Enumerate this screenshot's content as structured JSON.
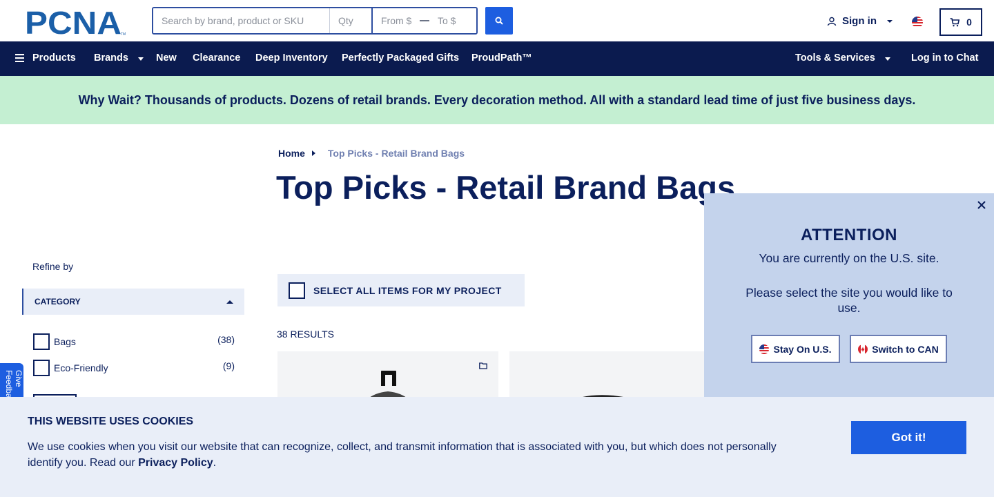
{
  "header": {
    "logo_text": "PCNA",
    "search": {
      "placeholder": "Search by brand, product or SKU",
      "value": ""
    },
    "qty": {
      "placeholder": "Qty",
      "value": ""
    },
    "price_from": {
      "placeholder": "From $",
      "value": ""
    },
    "price_to": {
      "placeholder": "To $",
      "value": ""
    },
    "search_icon": "search-icon",
    "sign_in_label": "Sign in",
    "country_flag": "us-flag-icon",
    "cart_count": "0"
  },
  "nav": {
    "products": "Products",
    "brands": "Brands",
    "new": "New",
    "clearance": "Clearance",
    "deep_inventory": "Deep Inventory",
    "gifts": "Perfectly Packaged Gifts",
    "proudpath": "ProudPath™",
    "tools": "Tools & Services",
    "chat": "Log in to Chat"
  },
  "banner": {
    "text": "Why Wait? Thousands of products. Dozens of retail brands. Every decoration method. All with a standard lead time of just five business days."
  },
  "breadcrumb": {
    "home": "Home",
    "current": "Top Picks - Retail Brand Bags"
  },
  "page_title": "Top Picks - Retail Brand Bags",
  "sidebar": {
    "refine_label": "Refine by",
    "category_header": "CATEGORY",
    "facets": [
      {
        "label": "Bags",
        "count": "(38)"
      },
      {
        "label": "Eco-Friendly",
        "count": "(9)"
      }
    ],
    "feedback_label": "Give Feedback"
  },
  "main": {
    "select_all_label": "SELECT ALL ITEMS FOR MY PROJECT",
    "results_label": "38 RESULTS"
  },
  "modal": {
    "title": "ATTENTION",
    "line1": "You are currently on the U.S. site.",
    "line2": "Please select the site you would like to use.",
    "stay_label": "Stay On U.S.",
    "switch_label": "Switch to CAN"
  },
  "cookie": {
    "title": "THIS WEBSITE USES COOKIES",
    "text": "We use cookies when you visit our website that can recognize, collect, and transmit information that is associated with you, but which does not personally identify you. Read our",
    "link": "Privacy Policy",
    "period": ".",
    "button": "Got it!"
  },
  "colors": {
    "navy": "#0b1b4f",
    "accent_blue": "#1d5ee0",
    "banner_green": "#c4efd2",
    "modal_bg": "#c4d3ec",
    "cookie_bg": "#e9eef8"
  }
}
